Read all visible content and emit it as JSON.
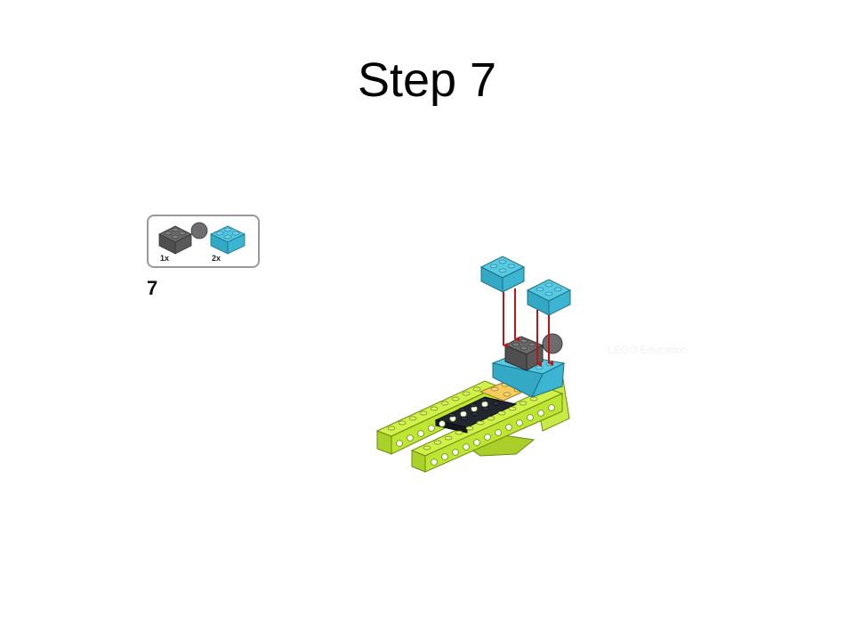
{
  "slide": {
    "title": "Step 7"
  },
  "instruction": {
    "step_number": "7",
    "parts": [
      {
        "icon": "dark-gray-brick-with-ball-icon",
        "quantity": "1x",
        "color": "#5f5f5f"
      },
      {
        "icon": "azure-brick-2x2-icon",
        "quantity": "2x",
        "color": "#3fb9d6"
      }
    ],
    "watermark": "LEGO Education"
  },
  "colors": {
    "lime": "#bde532",
    "azure": "#3fb9d6",
    "dark_gray": "#5f5f5f",
    "black": "#1b1f2a",
    "yellow": "#f7cc5b",
    "arrow_red": "#b8161a"
  }
}
